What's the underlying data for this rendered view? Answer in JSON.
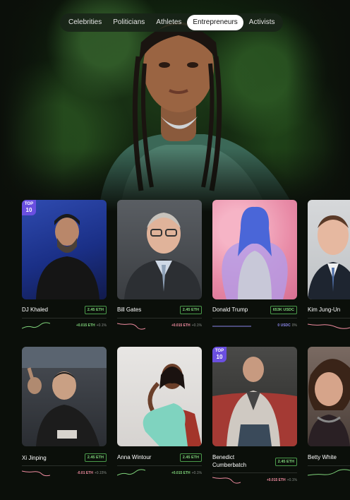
{
  "tabs": [
    {
      "label": "Celebrities",
      "active": false
    },
    {
      "label": "Politicians",
      "active": false
    },
    {
      "label": "Athletes",
      "active": false
    },
    {
      "label": "Entrepreneurs",
      "active": true
    },
    {
      "label": "Activists",
      "active": false
    }
  ],
  "badge": {
    "top": "TOP",
    "num": "10"
  },
  "cards": [
    {
      "name": "DJ Khaled",
      "price": "2.45 ETH",
      "change": "+0.015 ETH",
      "pct": "+0.1%",
      "trend": "up",
      "badge": true
    },
    {
      "name": "Bill Gates",
      "price": "2.45 ETH",
      "change": "+0.015 ETH",
      "pct": "+0.1%",
      "trend": "down",
      "badge": false
    },
    {
      "name": "Donald Trump",
      "price": "653K USDC",
      "change": "0 USDC",
      "pct": "0%",
      "trend": "flat",
      "badge": false
    },
    {
      "name": "Kim Jung-Un",
      "price": "",
      "change": "",
      "pct": "",
      "trend": "down",
      "badge": false
    },
    {
      "name": "Xi Jinping",
      "price": "2.45 ETH",
      "change": "-0.01 ETH",
      "pct": "+0.15%",
      "trend": "down",
      "badge": false
    },
    {
      "name": "Anna Wintour",
      "price": "2.45 ETH",
      "change": "+0.015 ETH",
      "pct": "+0.1%",
      "trend": "up",
      "badge": false
    },
    {
      "name": "Benedict Cumberbatch",
      "price": "2.45 ETH",
      "change": "+0.015 ETH",
      "pct": "+0.1%",
      "trend": "down",
      "badge": true
    },
    {
      "name": "Betty White",
      "price": "",
      "change": "",
      "pct": "",
      "trend": "up",
      "badge": false
    }
  ],
  "colors": {
    "up": "#7fd37a",
    "down": "#f08ca0",
    "flat": "#8a86e8",
    "badge": "#6a4fe0"
  }
}
